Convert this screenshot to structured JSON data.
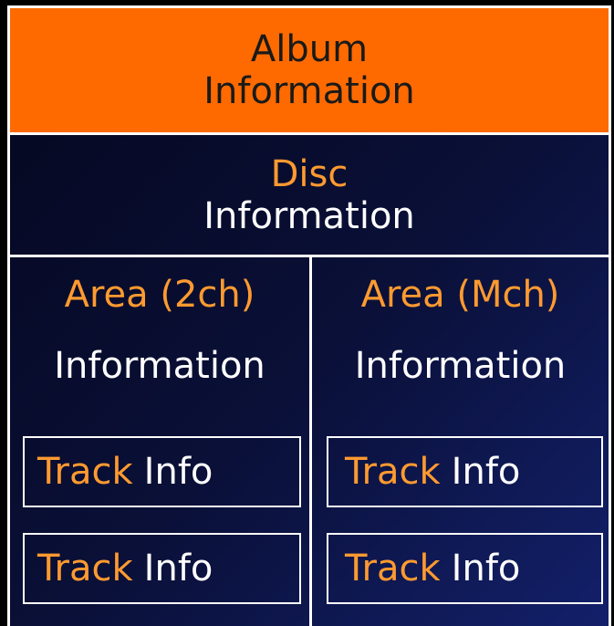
{
  "album": {
    "line1": "Album",
    "line2": "Information"
  },
  "disc": {
    "line1": "Disc",
    "line2": "Information"
  },
  "areas": [
    {
      "title": "Area (2ch)",
      "subtitle": "Information",
      "tracks": [
        {
          "word1": "Track",
          "word2": "Info"
        },
        {
          "word1": "Track",
          "word2": "Info"
        }
      ]
    },
    {
      "title": "Area (Mch)",
      "subtitle": "Information",
      "tracks": [
        {
          "word1": "Track",
          "word2": "Info"
        },
        {
          "word1": "Track",
          "word2": "Info"
        }
      ]
    }
  ],
  "colors": {
    "album_bg": "#ff6a00",
    "accent_text": "#ff9a30",
    "body_text": "#ffffff",
    "background": "#0a1038"
  }
}
